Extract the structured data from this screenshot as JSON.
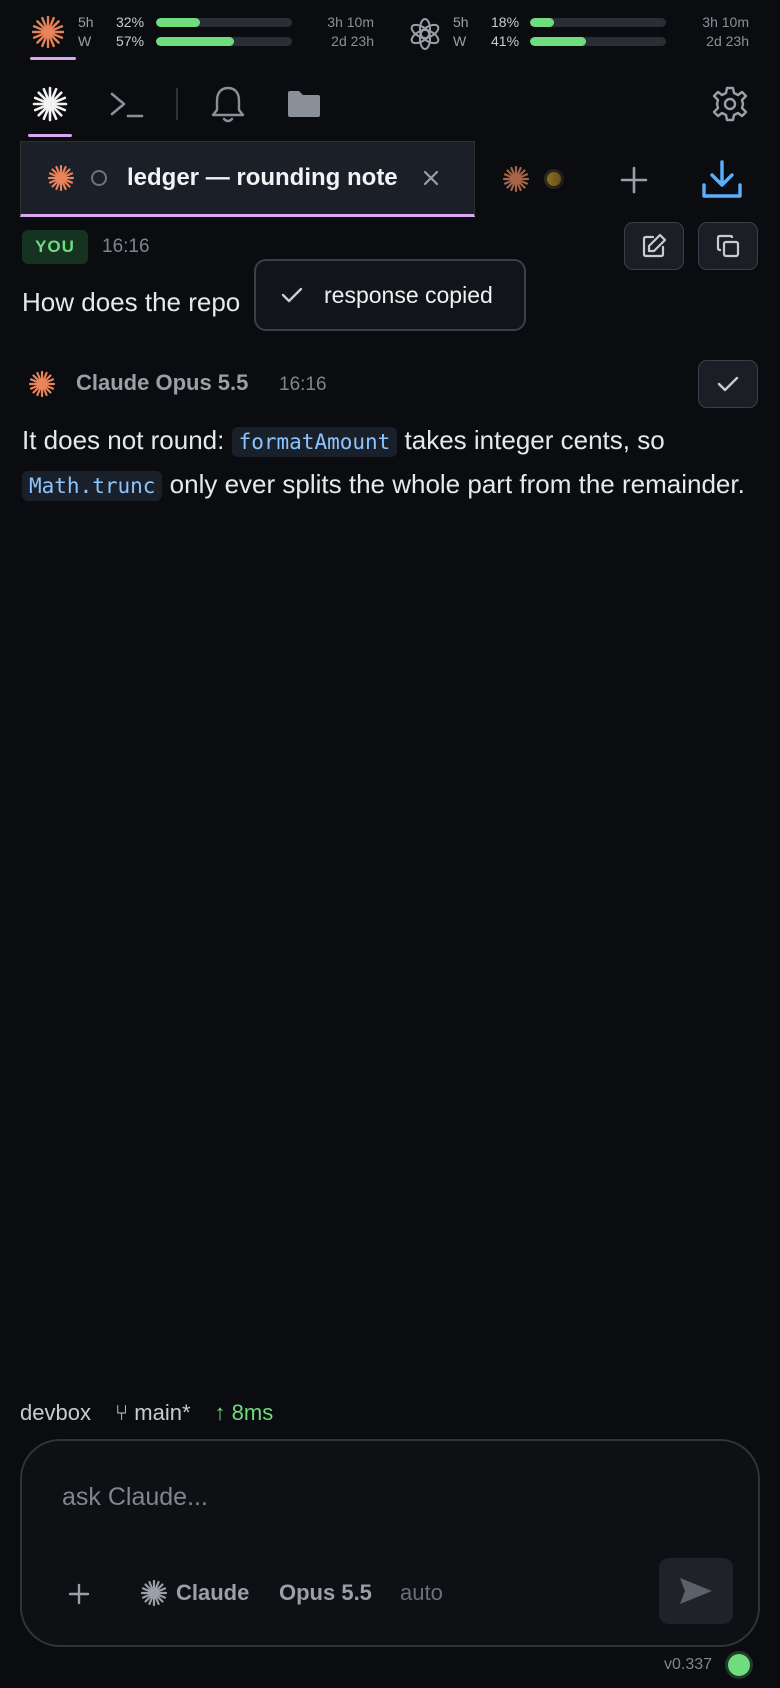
{
  "usage": {
    "claude": {
      "icon": "claude-starburst-icon",
      "rows": [
        {
          "label": "5h",
          "percent": "32%",
          "fill": 0.32,
          "time": "3h 10m"
        },
        {
          "label": "W",
          "percent": "57%",
          "fill": 0.57,
          "time": "2d 23h"
        }
      ]
    },
    "openai": {
      "icon": "openai-logo-icon",
      "rows": [
        {
          "label": "5h",
          "percent": "18%",
          "fill": 0.18,
          "time": "3h 10m"
        },
        {
          "label": "W",
          "percent": "41%",
          "fill": 0.41,
          "time": "2d 23h"
        }
      ]
    }
  },
  "toolbar": {
    "items": [
      "claude-starburst-icon",
      "terminal-icon",
      "bell-icon",
      "folder-icon"
    ],
    "settings_icon": "gear-icon"
  },
  "tabs": {
    "active_title": "ledger — rounding note",
    "close_icon": "close-icon",
    "new_tab_icon": "plus-icon",
    "download_icon": "download-icon"
  },
  "conversation": {
    "user": {
      "badge": "YOU",
      "time": "16:16",
      "text": "How does the repo"
    },
    "assistant": {
      "model": "Claude Opus 5.5",
      "time": "16:16",
      "text_part1": "It does not round: ",
      "code1": "formatAmount",
      "text_part2": " takes integer cents, so ",
      "code2": "Math.trunc",
      "text_part3": " only ever splits the whole part from the remainder."
    },
    "toast": "response copied"
  },
  "status": {
    "host": "devbox",
    "branch": "⑂ main*",
    "latency": "↑ 8ms"
  },
  "composer": {
    "placeholder": "ask Claude...",
    "agent": "Claude",
    "model": "Opus 5.5",
    "mode": "auto"
  },
  "version": "v0.337",
  "colors": {
    "accent_orange": "#e8835a",
    "accent_purple": "#d7a7f2",
    "status_green": "#6fdc7d",
    "link_blue": "#5ab0ff"
  }
}
